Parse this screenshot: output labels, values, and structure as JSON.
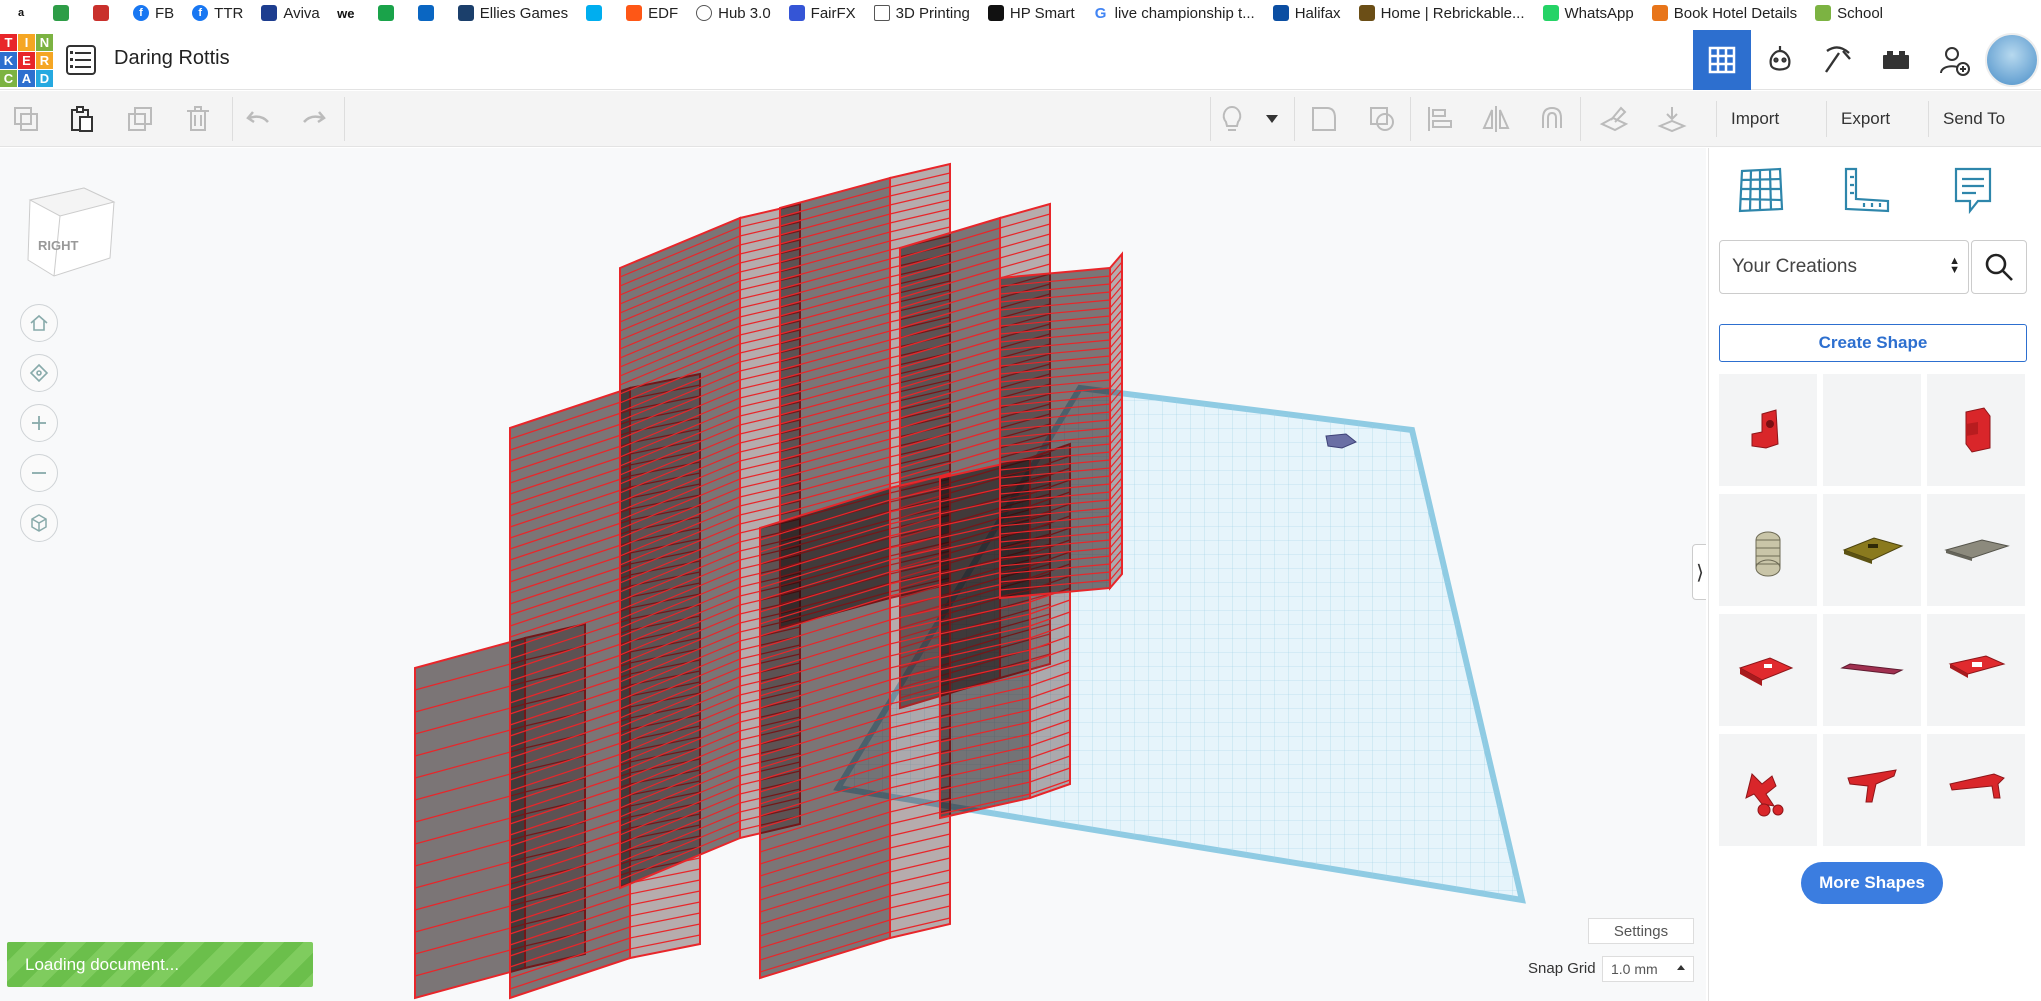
{
  "bookmarks": [
    {
      "label": "",
      "icon": "amazon-icon",
      "color": "#ffffff"
    },
    {
      "label": "",
      "icon": "green-app-icon",
      "color": "#2e9d47"
    },
    {
      "label": "",
      "icon": "shop-icon",
      "color": "#c9302c"
    },
    {
      "label": "FB",
      "icon": "facebook-icon",
      "color": "#1877f2"
    },
    {
      "label": "TTR",
      "icon": "facebook-icon",
      "color": "#1877f2"
    },
    {
      "label": "Aviva",
      "icon": "aviva-icon",
      "color": "#1d3d8f"
    },
    {
      "label": "",
      "icon": "we-icon",
      "color": "#111111"
    },
    {
      "label": "",
      "icon": "green-circle-icon",
      "color": "#1aa34a"
    },
    {
      "label": "",
      "icon": "linkedin-icon",
      "color": "#0a66c2"
    },
    {
      "label": "Ellies Games",
      "icon": "ellies-games-icon",
      "color": "#1b3f6b"
    },
    {
      "label": "",
      "icon": "barclays-icon",
      "color": "#00aeef"
    },
    {
      "label": "EDF",
      "icon": "edf-icon",
      "color": "#fe5716"
    },
    {
      "label": "Hub 3.0",
      "icon": "globe-icon",
      "color": "#555555"
    },
    {
      "label": "FairFX",
      "icon": "fairfx-icon",
      "color": "#3555d6"
    },
    {
      "label": "3D Printing",
      "icon": "folder-icon",
      "color": "#555555"
    },
    {
      "label": "HP Smart",
      "icon": "hp-icon",
      "color": "#111111"
    },
    {
      "label": "live championship t...",
      "icon": "google-icon",
      "color": "#4285f4"
    },
    {
      "label": "Halifax",
      "icon": "halifax-icon",
      "color": "#0b4ea2"
    },
    {
      "label": "Home | Rebrickable...",
      "icon": "rebrickable-icon",
      "color": "#6b4e16"
    },
    {
      "label": "WhatsApp",
      "icon": "whatsapp-icon",
      "color": "#25d366"
    },
    {
      "label": "Book Hotel Details",
      "icon": "booking-icon",
      "color": "#e8751a"
    },
    {
      "label": "School",
      "icon": "school-icon",
      "color": "#7cb342"
    }
  ],
  "header": {
    "logo_letters": [
      "T",
      "I",
      "N",
      "K",
      "E",
      "R",
      "C",
      "A",
      "D"
    ],
    "doc_title": "Daring Rottis"
  },
  "toolbar": {
    "import_label": "Import",
    "export_label": "Export",
    "send_to_label": "Send To"
  },
  "viewport": {
    "view_cube_label": "RIGHT",
    "settings_label": "Settings",
    "snap_grid_label": "Snap Grid",
    "snap_grid_value": "1.0 mm",
    "loading_text": "Loading document..."
  },
  "panel": {
    "library_select": "Your Creations",
    "create_shape_label": "Create Shape",
    "more_shapes_label": "More Shapes",
    "shapes": [
      "red-bracket-shape",
      "empty-shape",
      "red-box-shape",
      "threaded-cylinder-shape",
      "olive-tray-shape",
      "grey-plate-shape",
      "red-plate-shape",
      "maroon-bar-shape",
      "red-frame-shape",
      "red-robot-shape",
      "red-arm-shape",
      "red-rod-shape"
    ]
  },
  "colors": {
    "accent": "#2d6fcf",
    "wireframe": "#e8262a",
    "workplane": "#bfe3f2",
    "loading": "#6bbf4b"
  }
}
